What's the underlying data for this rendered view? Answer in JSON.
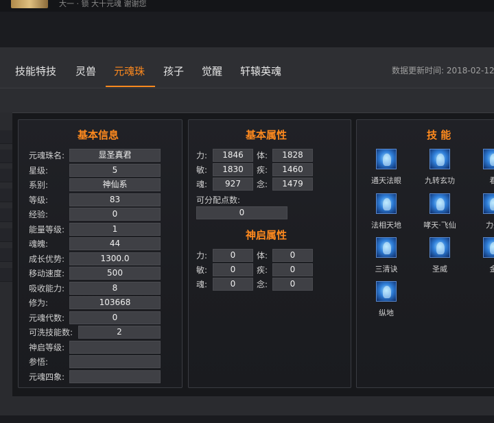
{
  "top": {
    "crumb": "大一  · 锁  大十元魂  谢谢您"
  },
  "tabs": [
    {
      "label": "技能特技",
      "active": false
    },
    {
      "label": "灵兽",
      "active": false
    },
    {
      "label": "元魂珠",
      "active": true
    },
    {
      "label": "孩子",
      "active": false
    },
    {
      "label": "觉醒",
      "active": false
    },
    {
      "label": "轩辕英魂",
      "active": false
    }
  ],
  "update_time": "数据更新时间:  2018-02-12",
  "basic_info": {
    "title": "基本信息",
    "rows": [
      {
        "label": "元魂珠名:",
        "value": "显圣真君"
      },
      {
        "label": "星级:",
        "value": "5"
      },
      {
        "label": "系别:",
        "value": "神仙系"
      },
      {
        "label": "等级:",
        "value": "83"
      },
      {
        "label": "经验:",
        "value": "0"
      },
      {
        "label": "能量等级:",
        "value": "1"
      },
      {
        "label": "魂魄:",
        "value": "44"
      },
      {
        "label": "成长优势:",
        "value": "1300.0"
      },
      {
        "label": "移动速度:",
        "value": "500"
      },
      {
        "label": "吸收能力:",
        "value": "8"
      },
      {
        "label": "修为:",
        "value": "103668"
      },
      {
        "label": "元魂代数:",
        "value": "0"
      },
      {
        "label": "可洗技能数:",
        "value": "2"
      },
      {
        "label": "神启等级:",
        "value": ""
      },
      {
        "label": "参悟:",
        "value": ""
      },
      {
        "label": "元魂四象:",
        "value": ""
      }
    ]
  },
  "basic_attrs": {
    "title": "基本属性",
    "rows": [
      {
        "l1": "力:",
        "v1": "1846",
        "l2": "体:",
        "v2": "1828"
      },
      {
        "l1": "敏:",
        "v1": "1830",
        "l2": "疾:",
        "v2": "1460"
      },
      {
        "l1": "魂:",
        "v1": "927",
        "l2": "念:",
        "v2": "1479"
      }
    ],
    "points_label": "可分配点数:",
    "points_value": "0"
  },
  "divine_attrs": {
    "title": "神启属性",
    "rows": [
      {
        "l1": "力:",
        "v1": "0",
        "l2": "体:",
        "v2": "0"
      },
      {
        "l1": "敏:",
        "v1": "0",
        "l2": "疾:",
        "v2": "0"
      },
      {
        "l1": "魂:",
        "v1": "0",
        "l2": "念:",
        "v2": "0"
      }
    ]
  },
  "skills": {
    "title": "技 能",
    "items": [
      {
        "name": "通天法眼",
        "icon": "skill-eye-icon"
      },
      {
        "name": "九转玄功",
        "icon": "skill-meditation-icon"
      },
      {
        "name": "看",
        "icon": "skill-icon"
      },
      {
        "name": "法相天地",
        "icon": "skill-giant-icon"
      },
      {
        "name": "哮天·飞仙",
        "icon": "skill-hound-icon"
      },
      {
        "name": "力劈",
        "icon": "skill-icon"
      },
      {
        "name": "三清诀",
        "icon": "skill-trinity-icon"
      },
      {
        "name": "圣威",
        "icon": "skill-might-icon"
      },
      {
        "name": "金",
        "icon": "skill-icon"
      },
      {
        "name": "纵地",
        "icon": "skill-leap-icon"
      }
    ]
  },
  "colors": {
    "accent": "#ff8a1e",
    "panel_border": "#3a3c42",
    "value_bg": "#3f4045"
  }
}
